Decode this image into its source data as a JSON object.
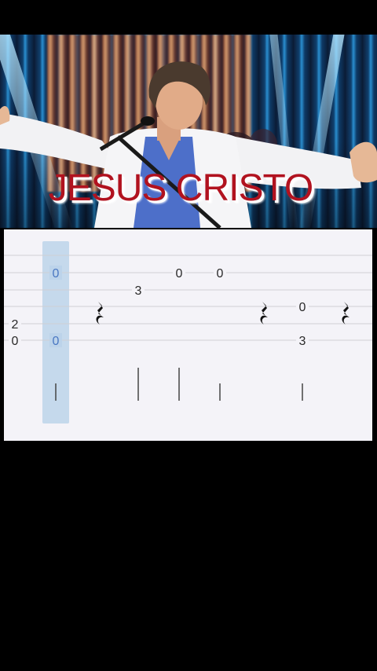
{
  "video": {
    "title_overlay": "JESUS CRISTO"
  },
  "tablature": {
    "cursor_column": 1,
    "notes": [
      {
        "string": 4,
        "column": 0,
        "fret": "2"
      },
      {
        "string": 5,
        "column": 0,
        "fret": "0"
      },
      {
        "string": 1,
        "column": 1,
        "fret": "0"
      },
      {
        "string": 5,
        "column": 1,
        "fret": "0"
      },
      {
        "string": 2,
        "column": 3,
        "fret": "3"
      },
      {
        "string": 1,
        "column": 4,
        "fret": "0"
      },
      {
        "string": 1,
        "column": 5,
        "fret": "0"
      },
      {
        "string": 3,
        "column": 7,
        "fret": "0"
      },
      {
        "string": 5,
        "column": 7,
        "fret": "3"
      }
    ],
    "rests": [
      2,
      6,
      8
    ],
    "stems": [
      1,
      3,
      4,
      5,
      7
    ]
  }
}
